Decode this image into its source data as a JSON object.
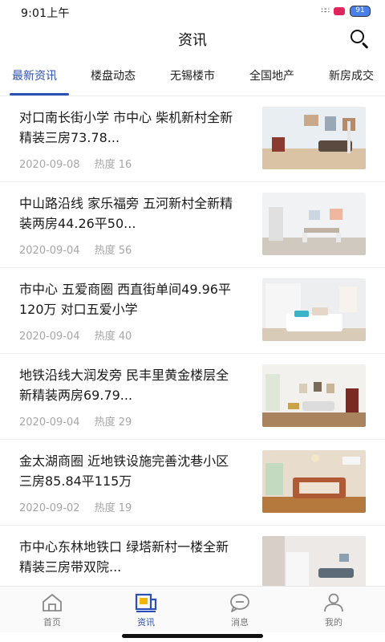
{
  "status": {
    "time": "9:01上午",
    "battery": "91"
  },
  "header": {
    "title": "资讯"
  },
  "tabs": [
    "最新资讯",
    "楼盘动态",
    "无锡楼市",
    "全国地产",
    "新房成交"
  ],
  "articles": [
    {
      "title": "对口南长街小学 市中心 柴机新村全新精装三房73.78...",
      "date": "2020-09-08",
      "heat": "热度 16"
    },
    {
      "title": "中山路沿线 家乐福旁 五河新村全新精装两房44.26平50...",
      "date": "2020-09-04",
      "heat": "热度 56"
    },
    {
      "title": " 市中心 五爱商圈 西直街单间49.96平120万 对口五爱小学",
      "date": "2020-09-04",
      "heat": "热度 40"
    },
    {
      "title": "地铁沿线大润发旁 民丰里黄金楼层全新精装两房69.79...",
      "date": "2020-09-04",
      "heat": "热度 29"
    },
    {
      "title": "金太湖商圈 近地铁设施完善沈巷小区三房85.84平115万",
      "date": "2020-09-02",
      "heat": "热度 19"
    },
    {
      "title": "市中心东林地铁口 绿塔新村一楼全新精装三房带双院...",
      "date": "",
      "heat": ""
    }
  ],
  "bottom_tabs": [
    "首页",
    "资讯",
    "消息",
    "我的"
  ],
  "colors": {
    "accent": "#2b4fb8",
    "meta_text": "#a6a6a6",
    "divider": "#efefef"
  }
}
